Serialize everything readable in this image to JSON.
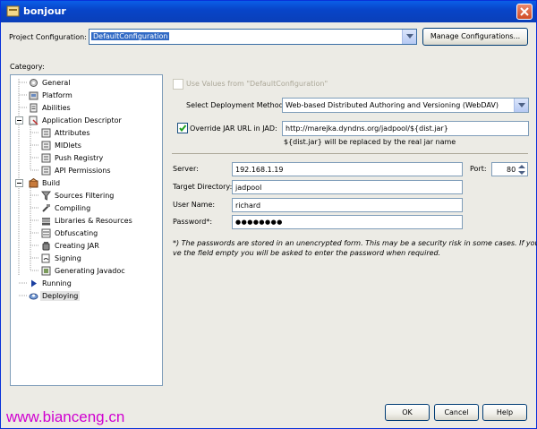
{
  "window": {
    "title": "bonjour"
  },
  "project_config": {
    "label": "Project Configuration:",
    "value": "DefaultConfiguration",
    "manage_label": "Manage Configurations..."
  },
  "category": {
    "label": "Category:",
    "items": [
      {
        "label": "General"
      },
      {
        "label": "Platform"
      },
      {
        "label": "Abilities"
      },
      {
        "label": "Application Descriptor"
      },
      {
        "label": "Attributes"
      },
      {
        "label": "MIDlets"
      },
      {
        "label": "Push Registry"
      },
      {
        "label": "API Permissions"
      },
      {
        "label": "Build"
      },
      {
        "label": "Sources Filtering"
      },
      {
        "label": "Compiling"
      },
      {
        "label": "Libraries & Resources"
      },
      {
        "label": "Obfuscating"
      },
      {
        "label": "Creating JAR"
      },
      {
        "label": "Signing"
      },
      {
        "label": "Generating Javadoc"
      },
      {
        "label": "Running"
      },
      {
        "label": "Deploying"
      }
    ]
  },
  "deploy": {
    "use_values_label": "Use Values from \"DefaultConfiguration\"",
    "method_label": "Select Deployment Method:",
    "method_value": "Web-based Distributed Authoring and Versioning (WebDAV)",
    "override_label": "Override JAR URL in JAD:",
    "override_value": "http://marejka.dyndns.org/jadpool/${dist.jar}",
    "override_hint": "${dist.jar} will be replaced by the real jar name",
    "server_label": "Server:",
    "server_value": "192.168.1.19",
    "port_label": "Port:",
    "port_value": "80",
    "target_label": "Target Directory:",
    "target_value": "jadpool",
    "user_label": "User Name:",
    "user_value": "richard",
    "password_label": "Password*:",
    "password_value": "●●●●●●●●",
    "note_line1": "*) The passwords are stored in an unencrypted form. This may be a security risk in some cases. If you lea",
    "note_line2": "ve the field empty you will be asked to enter the password when required."
  },
  "buttons": {
    "ok": "OK",
    "cancel": "Cancel",
    "help": "Help"
  },
  "watermark": "www.bianceng.cn"
}
